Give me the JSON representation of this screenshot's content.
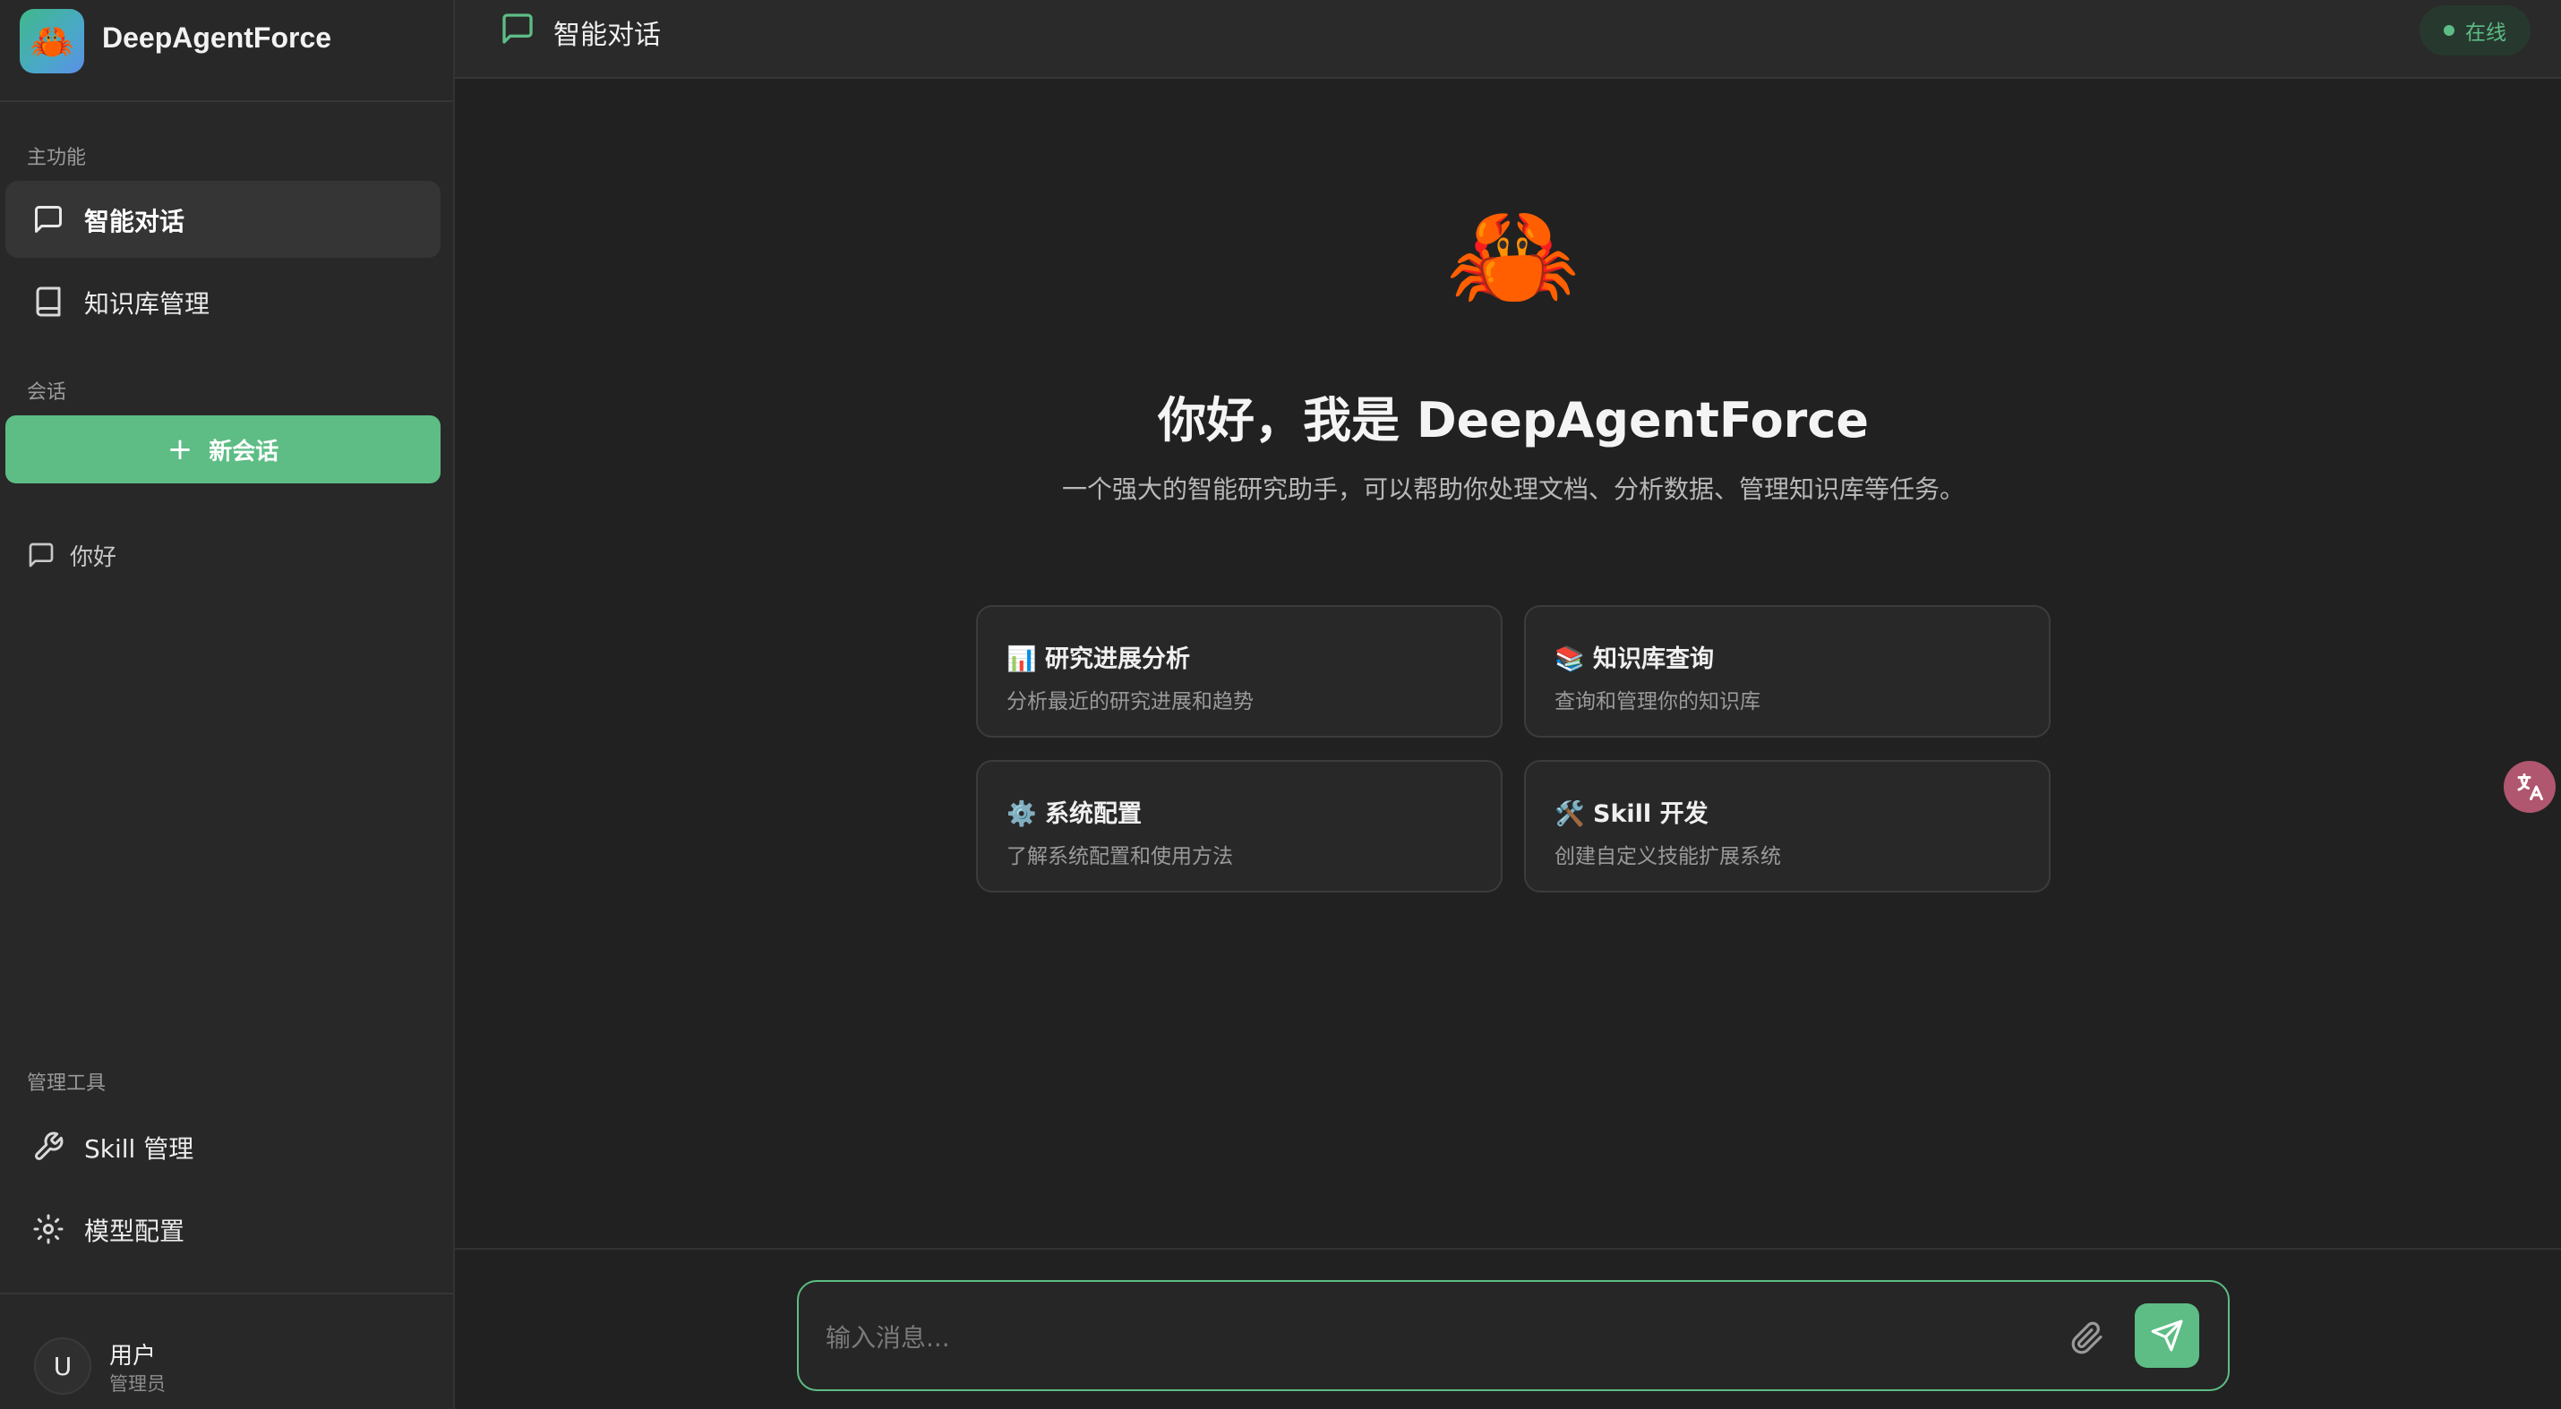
{
  "app": {
    "name": "DeepAgentForce",
    "logo_emoji": "🦀"
  },
  "sidebar": {
    "sections": {
      "main": "主功能",
      "conversation": "会话",
      "admin": "管理工具"
    },
    "main_items": [
      {
        "label": "智能对话",
        "icon": "chat-icon",
        "active": true
      },
      {
        "label": "知识库管理",
        "icon": "book-icon",
        "active": false
      }
    ],
    "new_chat_label": "新会话",
    "conversations": [
      {
        "label": "你好",
        "icon": "chat-icon"
      }
    ],
    "admin_items": [
      {
        "label": "Skill 管理",
        "icon": "wrench-icon"
      },
      {
        "label": "模型配置",
        "icon": "gear-icon"
      }
    ],
    "user": {
      "avatar_letter": "U",
      "name": "用户",
      "role": "管理员"
    }
  },
  "header": {
    "title": "智能对话",
    "status": "在线"
  },
  "welcome": {
    "emoji": "🦀",
    "title": "你好，我是 DeepAgentForce",
    "subtitle": "一个强大的智能研究助手，可以帮助你处理文档、分析数据、管理知识库等任务。",
    "cards": [
      {
        "title": "📊 研究进展分析",
        "desc": "分析最近的研究进展和趋势"
      },
      {
        "title": "📚 知识库查询",
        "desc": "查询和管理你的知识库"
      },
      {
        "title": "⚙️ 系统配置",
        "desc": "了解系统配置和使用方法"
      },
      {
        "title": "🛠️ Skill 开发",
        "desc": "创建自定义技能扩展系统"
      }
    ]
  },
  "composer": {
    "placeholder": "输入消息...",
    "value": ""
  },
  "colors": {
    "accent": "#5dbd85",
    "background": "#212121",
    "sidebar": "#282828"
  }
}
